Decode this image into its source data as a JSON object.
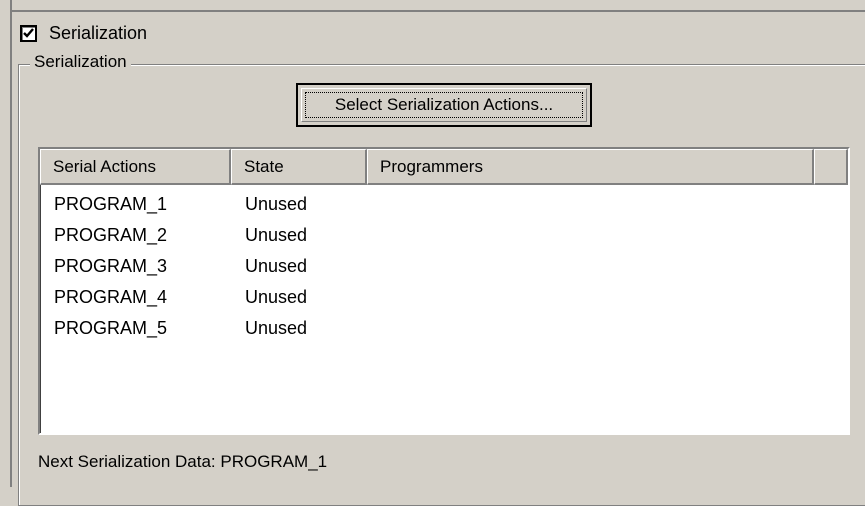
{
  "checkbox": {
    "label": "Serialization",
    "checked": true
  },
  "group": {
    "title": "Serialization"
  },
  "select_button": {
    "label": "Select Serialization Actions..."
  },
  "list": {
    "columns": [
      "Serial Actions",
      "State",
      "Programmers",
      ""
    ],
    "rows": [
      [
        "PROGRAM_1",
        "Unused",
        ""
      ],
      [
        "PROGRAM_2",
        "Unused",
        ""
      ],
      [
        "PROGRAM_3",
        "Unused",
        ""
      ],
      [
        "PROGRAM_4",
        "Unused",
        ""
      ],
      [
        "PROGRAM_5",
        "Unused",
        ""
      ]
    ]
  },
  "footer": {
    "next_data": "Next Serialization Data: PROGRAM_1"
  }
}
